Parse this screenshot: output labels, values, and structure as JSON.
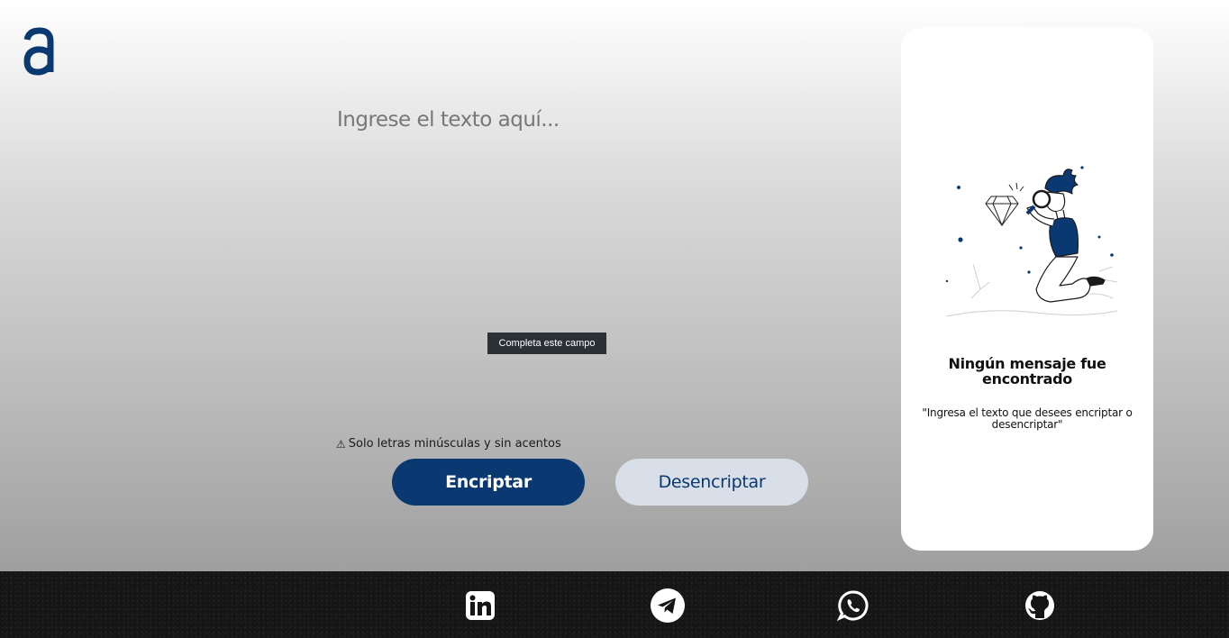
{
  "brand": {
    "logo_icon": "a-logo-icon",
    "color": "#0a3871"
  },
  "editor": {
    "placeholder": "Ingrese el texto aquí...",
    "validation_tooltip": "Completa este campo"
  },
  "hint": {
    "icon": "warning-icon",
    "text": "Solo letras minúsculas y sin acentos"
  },
  "actions": {
    "encrypt_label": "Encriptar",
    "decrypt_label": "Desencriptar"
  },
  "output_panel": {
    "illustration": "person-with-magnifier-illustration",
    "title": "Ningún mensaje fue encontrado",
    "description": "\"Ingresa el texto que desees encriptar o desencriptar\""
  },
  "footer": {
    "links": [
      {
        "name": "linkedin-icon"
      },
      {
        "name": "telegram-icon"
      },
      {
        "name": "whatsapp-icon"
      },
      {
        "name": "github-icon"
      }
    ]
  },
  "colors": {
    "primary": "#0a3871",
    "secondary_button": "#d8dfe8",
    "footer_bg": "#151515"
  }
}
